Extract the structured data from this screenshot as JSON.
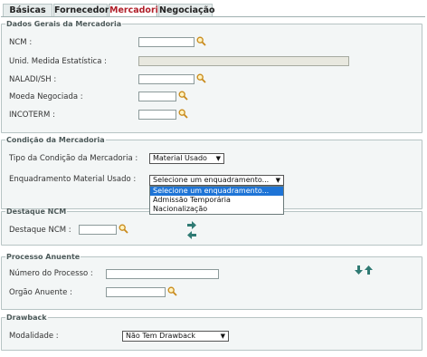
{
  "tabs": [
    {
      "label": "Básicas"
    },
    {
      "label": "Fornecedor"
    },
    {
      "label": "Mercadoria"
    },
    {
      "label": "Negociação"
    }
  ],
  "dados_gerais": {
    "title": "Dados Gerais da Mercadoria",
    "ncm_label": "NCM :",
    "ncm_value": "",
    "unid_label": "Unid. Medida Estatística :",
    "unid_value": "",
    "naladi_label": "NALADI/SH :",
    "naladi_value": "",
    "moeda_label": "Moeda Negociada :",
    "moeda_value": "",
    "incoterm_label": "INCOTERM :",
    "incoterm_value": ""
  },
  "condicao": {
    "title": "Condição da Mercadoria",
    "tipo_label": "Tipo da Condição da Mercadoria :",
    "tipo_value": "Material Usado",
    "enquadramento_label": "Enquadramento Material Usado :",
    "enquadramento_value": "Selecione um enquadramento...",
    "options": [
      {
        "label": "Selecione um enquadramento..."
      },
      {
        "label": "Admissão Temporária"
      },
      {
        "label": "Nacionalização"
      }
    ]
  },
  "destaque": {
    "title": "Destaque NCM",
    "destaque_label": "Destaque NCM :",
    "destaque_value": ""
  },
  "processo": {
    "title": "Processo Anuente",
    "numero_label": "Número do Processo :",
    "numero_value": "",
    "orgao_label": "Orgão Anuente :",
    "orgao_value": ""
  },
  "drawback": {
    "title": "Drawback",
    "modalidade_label": "Modalidade :",
    "modalidade_value": "Não Tem Drawback"
  },
  "colors": {
    "accent_tab": "#b0202a",
    "section_bg": "#f3f6f6",
    "arrow_green": "#2f7a73",
    "selected_option": "#1e74d6"
  },
  "icons": {
    "lookup": "magnifier-icon",
    "move_right": "arrow-right-icon",
    "move_left": "arrow-left-icon",
    "move_down": "arrow-down-icon",
    "move_up": "arrow-up-icon"
  }
}
